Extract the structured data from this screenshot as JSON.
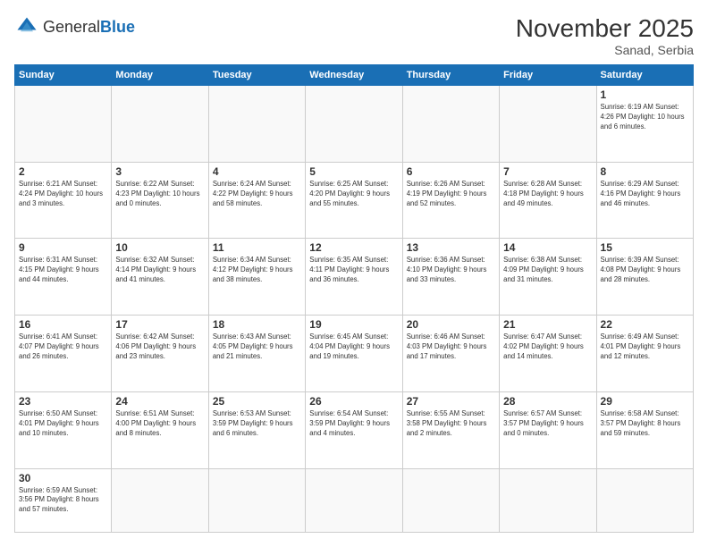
{
  "logo": {
    "general": "General",
    "blue": "Blue"
  },
  "title": {
    "month_year": "November 2025",
    "location": "Sanad, Serbia"
  },
  "weekdays": [
    "Sunday",
    "Monday",
    "Tuesday",
    "Wednesday",
    "Thursday",
    "Friday",
    "Saturday"
  ],
  "weeks": [
    [
      {
        "day": "",
        "info": ""
      },
      {
        "day": "",
        "info": ""
      },
      {
        "day": "",
        "info": ""
      },
      {
        "day": "",
        "info": ""
      },
      {
        "day": "",
        "info": ""
      },
      {
        "day": "",
        "info": ""
      },
      {
        "day": "1",
        "info": "Sunrise: 6:19 AM\nSunset: 4:26 PM\nDaylight: 10 hours and 6 minutes."
      }
    ],
    [
      {
        "day": "2",
        "info": "Sunrise: 6:21 AM\nSunset: 4:24 PM\nDaylight: 10 hours and 3 minutes."
      },
      {
        "day": "3",
        "info": "Sunrise: 6:22 AM\nSunset: 4:23 PM\nDaylight: 10 hours and 0 minutes."
      },
      {
        "day": "4",
        "info": "Sunrise: 6:24 AM\nSunset: 4:22 PM\nDaylight: 9 hours and 58 minutes."
      },
      {
        "day": "5",
        "info": "Sunrise: 6:25 AM\nSunset: 4:20 PM\nDaylight: 9 hours and 55 minutes."
      },
      {
        "day": "6",
        "info": "Sunrise: 6:26 AM\nSunset: 4:19 PM\nDaylight: 9 hours and 52 minutes."
      },
      {
        "day": "7",
        "info": "Sunrise: 6:28 AM\nSunset: 4:18 PM\nDaylight: 9 hours and 49 minutes."
      },
      {
        "day": "8",
        "info": "Sunrise: 6:29 AM\nSunset: 4:16 PM\nDaylight: 9 hours and 46 minutes."
      }
    ],
    [
      {
        "day": "9",
        "info": "Sunrise: 6:31 AM\nSunset: 4:15 PM\nDaylight: 9 hours and 44 minutes."
      },
      {
        "day": "10",
        "info": "Sunrise: 6:32 AM\nSunset: 4:14 PM\nDaylight: 9 hours and 41 minutes."
      },
      {
        "day": "11",
        "info": "Sunrise: 6:34 AM\nSunset: 4:12 PM\nDaylight: 9 hours and 38 minutes."
      },
      {
        "day": "12",
        "info": "Sunrise: 6:35 AM\nSunset: 4:11 PM\nDaylight: 9 hours and 36 minutes."
      },
      {
        "day": "13",
        "info": "Sunrise: 6:36 AM\nSunset: 4:10 PM\nDaylight: 9 hours and 33 minutes."
      },
      {
        "day": "14",
        "info": "Sunrise: 6:38 AM\nSunset: 4:09 PM\nDaylight: 9 hours and 31 minutes."
      },
      {
        "day": "15",
        "info": "Sunrise: 6:39 AM\nSunset: 4:08 PM\nDaylight: 9 hours and 28 minutes."
      }
    ],
    [
      {
        "day": "16",
        "info": "Sunrise: 6:41 AM\nSunset: 4:07 PM\nDaylight: 9 hours and 26 minutes."
      },
      {
        "day": "17",
        "info": "Sunrise: 6:42 AM\nSunset: 4:06 PM\nDaylight: 9 hours and 23 minutes."
      },
      {
        "day": "18",
        "info": "Sunrise: 6:43 AM\nSunset: 4:05 PM\nDaylight: 9 hours and 21 minutes."
      },
      {
        "day": "19",
        "info": "Sunrise: 6:45 AM\nSunset: 4:04 PM\nDaylight: 9 hours and 19 minutes."
      },
      {
        "day": "20",
        "info": "Sunrise: 6:46 AM\nSunset: 4:03 PM\nDaylight: 9 hours and 17 minutes."
      },
      {
        "day": "21",
        "info": "Sunrise: 6:47 AM\nSunset: 4:02 PM\nDaylight: 9 hours and 14 minutes."
      },
      {
        "day": "22",
        "info": "Sunrise: 6:49 AM\nSunset: 4:01 PM\nDaylight: 9 hours and 12 minutes."
      }
    ],
    [
      {
        "day": "23",
        "info": "Sunrise: 6:50 AM\nSunset: 4:01 PM\nDaylight: 9 hours and 10 minutes."
      },
      {
        "day": "24",
        "info": "Sunrise: 6:51 AM\nSunset: 4:00 PM\nDaylight: 9 hours and 8 minutes."
      },
      {
        "day": "25",
        "info": "Sunrise: 6:53 AM\nSunset: 3:59 PM\nDaylight: 9 hours and 6 minutes."
      },
      {
        "day": "26",
        "info": "Sunrise: 6:54 AM\nSunset: 3:59 PM\nDaylight: 9 hours and 4 minutes."
      },
      {
        "day": "27",
        "info": "Sunrise: 6:55 AM\nSunset: 3:58 PM\nDaylight: 9 hours and 2 minutes."
      },
      {
        "day": "28",
        "info": "Sunrise: 6:57 AM\nSunset: 3:57 PM\nDaylight: 9 hours and 0 minutes."
      },
      {
        "day": "29",
        "info": "Sunrise: 6:58 AM\nSunset: 3:57 PM\nDaylight: 8 hours and 59 minutes."
      }
    ],
    [
      {
        "day": "30",
        "info": "Sunrise: 6:59 AM\nSunset: 3:56 PM\nDaylight: 8 hours and 57 minutes."
      },
      {
        "day": "",
        "info": ""
      },
      {
        "day": "",
        "info": ""
      },
      {
        "day": "",
        "info": ""
      },
      {
        "day": "",
        "info": ""
      },
      {
        "day": "",
        "info": ""
      },
      {
        "day": "",
        "info": ""
      }
    ]
  ]
}
